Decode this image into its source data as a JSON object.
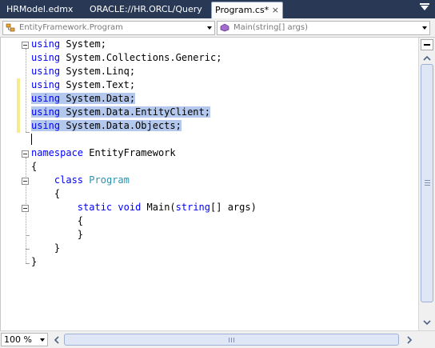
{
  "tabs": [
    {
      "label": "HRModel.edmx",
      "active": false
    },
    {
      "label": "ORACLE://HR.ORCL/Query",
      "active": false
    },
    {
      "label": "Program.cs*",
      "active": true
    }
  ],
  "tab_close_glyph": "×",
  "navbar": {
    "type_combo": {
      "value": "EntityFramework.Program",
      "icon": "class-icon"
    },
    "member_combo": {
      "value": "Main(string[] args)",
      "icon": "method-icon"
    }
  },
  "code_lines": [
    {
      "text": "using System;"
    },
    {
      "text": "using System.Collections.Generic;"
    },
    {
      "text": "using System.Linq;"
    },
    {
      "text": "using System.Text;"
    },
    {
      "text": "using System.Data;"
    },
    {
      "text": "using System.Data.EntityClient;"
    },
    {
      "text": "using System.Data.Objects;"
    },
    {
      "text": ""
    },
    {
      "text": "namespace EntityFramework"
    },
    {
      "text": "{"
    },
    {
      "text": "    class Program"
    },
    {
      "text": "    {"
    },
    {
      "text": "        static void Main(string[] args)"
    },
    {
      "text": "        {"
    },
    {
      "text": "        }"
    },
    {
      "text": "    }"
    },
    {
      "text": "}"
    }
  ],
  "zoom": "100 %",
  "colors": {
    "keyword": "#0000ff",
    "type": "#2b91af",
    "selection": "#b4c8ee",
    "changed_line_bar": "#f7ec8b",
    "tab_strip": "#293955"
  }
}
